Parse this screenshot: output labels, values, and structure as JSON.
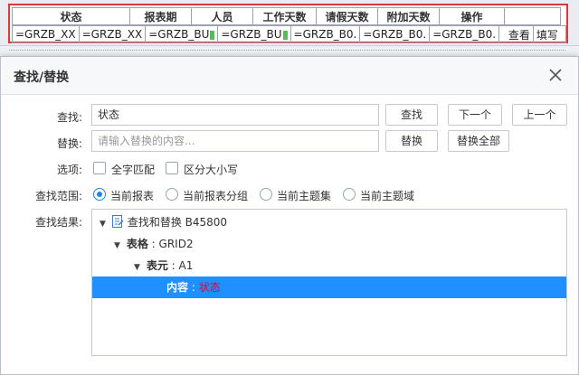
{
  "sheet": {
    "headers": [
      "状态",
      "",
      "报表期",
      "人员",
      "工作天数",
      "请假天数",
      "附加天数",
      "操作",
      ""
    ],
    "row": [
      "=GRZB_XX",
      "=GRZB_XX",
      "=GRZB_BU",
      "=GRZB_BU",
      "=GRZB_B0.",
      "=GRZB_B0.",
      "=GRZB_B0.",
      "查看",
      "填写"
    ]
  },
  "dialog": {
    "title": "查找/替换",
    "find_label": "查找:",
    "find_value": "状态",
    "replace_label": "替换:",
    "replace_placeholder": "请输入替换的内容...",
    "buttons": {
      "find": "查找",
      "next": "下一个",
      "prev": "上一个",
      "replace": "替换",
      "replace_all": "替换全部"
    },
    "options_label": "选项:",
    "option_whole_word": "全字匹配",
    "option_case": "区分大小写",
    "scope_label": "查找范围:",
    "scopes": [
      "当前报表",
      "当前报表分组",
      "当前主题集",
      "当前主题域"
    ],
    "scope_selected": "当前报表",
    "results_label": "查找结果:",
    "results": {
      "root": "查找和替换 B45800",
      "level1_key": "表格",
      "level1_value": "GRID2",
      "level2_key": "表元",
      "level2_value": "A1",
      "level3_key": "内容",
      "level3_value": "状态"
    }
  }
}
